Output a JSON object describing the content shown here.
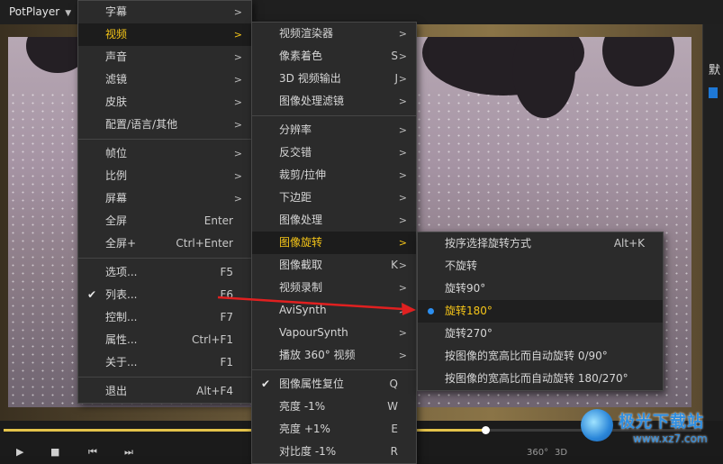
{
  "app": {
    "title": "PotPlayer"
  },
  "main_menu": [
    {
      "label": "字幕",
      "shortcut": "",
      "submenu": true,
      "type": "item"
    },
    {
      "label": "视频",
      "shortcut": "",
      "submenu": true,
      "type": "item",
      "highlight": true
    },
    {
      "label": "声音",
      "shortcut": "",
      "submenu": true,
      "type": "item"
    },
    {
      "label": "滤镜",
      "shortcut": "",
      "submenu": true,
      "type": "item"
    },
    {
      "label": "皮肤",
      "shortcut": "",
      "submenu": true,
      "type": "item"
    },
    {
      "label": "配置/语言/其他",
      "shortcut": "",
      "submenu": true,
      "type": "item"
    },
    {
      "type": "sep"
    },
    {
      "label": "帧位",
      "shortcut": "",
      "submenu": true,
      "type": "item"
    },
    {
      "label": "比例",
      "shortcut": "",
      "submenu": true,
      "type": "item"
    },
    {
      "label": "屏幕",
      "shortcut": "",
      "submenu": true,
      "type": "item"
    },
    {
      "label": "全屏",
      "shortcut": "Enter",
      "submenu": false,
      "type": "item"
    },
    {
      "label": "全屏+",
      "shortcut": "Ctrl+Enter",
      "submenu": false,
      "type": "item"
    },
    {
      "type": "sep"
    },
    {
      "label": "选项...",
      "shortcut": "F5",
      "submenu": false,
      "type": "item"
    },
    {
      "label": "列表...",
      "shortcut": "F6",
      "submenu": false,
      "type": "item",
      "checked": true
    },
    {
      "label": "控制...",
      "shortcut": "F7",
      "submenu": false,
      "type": "item"
    },
    {
      "label": "属性...",
      "shortcut": "Ctrl+F1",
      "submenu": false,
      "type": "item"
    },
    {
      "label": "关于...",
      "shortcut": "F1",
      "submenu": false,
      "type": "item"
    },
    {
      "type": "sep"
    },
    {
      "label": "退出",
      "shortcut": "Alt+F4",
      "submenu": false,
      "type": "item"
    }
  ],
  "video_menu": [
    {
      "label": "视频渲染器",
      "shortcut": "",
      "submenu": true,
      "type": "item"
    },
    {
      "label": "像素着色",
      "shortcut": "S",
      "submenu": true,
      "type": "item"
    },
    {
      "label": "3D 视频输出",
      "shortcut": "J",
      "submenu": true,
      "type": "item"
    },
    {
      "label": "图像处理滤镜",
      "shortcut": "",
      "submenu": true,
      "type": "item"
    },
    {
      "type": "sep"
    },
    {
      "label": "分辨率",
      "shortcut": "",
      "submenu": true,
      "type": "item"
    },
    {
      "label": "反交错",
      "shortcut": "",
      "submenu": true,
      "type": "item"
    },
    {
      "label": "裁剪/拉伸",
      "shortcut": "",
      "submenu": true,
      "type": "item"
    },
    {
      "label": "下边距",
      "shortcut": "",
      "submenu": true,
      "type": "item"
    },
    {
      "label": "图像处理",
      "shortcut": "",
      "submenu": true,
      "type": "item"
    },
    {
      "label": "图像旋转",
      "shortcut": "",
      "submenu": true,
      "type": "item",
      "highlight": true
    },
    {
      "label": "图像截取",
      "shortcut": "K",
      "submenu": true,
      "type": "item"
    },
    {
      "label": "视频录制",
      "shortcut": "",
      "submenu": true,
      "type": "item"
    },
    {
      "label": "AviSynth",
      "shortcut": "",
      "submenu": true,
      "type": "item"
    },
    {
      "label": "VapourSynth",
      "shortcut": "",
      "submenu": true,
      "type": "item"
    },
    {
      "label": "播放 360° 视频",
      "shortcut": "",
      "submenu": true,
      "type": "item"
    },
    {
      "type": "sep"
    },
    {
      "label": "图像属性复位",
      "shortcut": "Q",
      "submenu": false,
      "type": "item",
      "checked": true
    },
    {
      "label": "亮度 -1%",
      "shortcut": "W",
      "submenu": false,
      "type": "item"
    },
    {
      "label": "亮度 +1%",
      "shortcut": "E",
      "submenu": false,
      "type": "item"
    },
    {
      "label": "对比度 -1%",
      "shortcut": "R",
      "submenu": false,
      "type": "item"
    }
  ],
  "rotate_menu": [
    {
      "label": "按序选择旋转方式",
      "shortcut": "Alt+K",
      "type": "item"
    },
    {
      "label": "不旋转",
      "shortcut": "",
      "type": "item"
    },
    {
      "label": "旋转90°",
      "shortcut": "",
      "type": "item"
    },
    {
      "label": "旋转180°",
      "shortcut": "",
      "type": "item",
      "selected": true
    },
    {
      "label": "旋转270°",
      "shortcut": "",
      "type": "item"
    },
    {
      "label": "按图像的宽高比而自动旋转 0/90°",
      "shortcut": "",
      "type": "item"
    },
    {
      "label": "按图像的宽高比而自动旋转 180/270°",
      "shortcut": "",
      "type": "item"
    }
  ],
  "right_panel": {
    "text": "默"
  },
  "controls": {
    "info_360": "360°",
    "info_3d": "3D"
  },
  "watermark": {
    "title": "极光下载站",
    "url": "www.xz7.com"
  },
  "colors": {
    "highlight_text": "#f5c518",
    "menu_bg": "#2b2b2b",
    "radio_dot": "#2c8ff0",
    "annotation_arrow": "#e02020"
  },
  "seek": {
    "progress": 0.69,
    "volume": 0.86
  }
}
